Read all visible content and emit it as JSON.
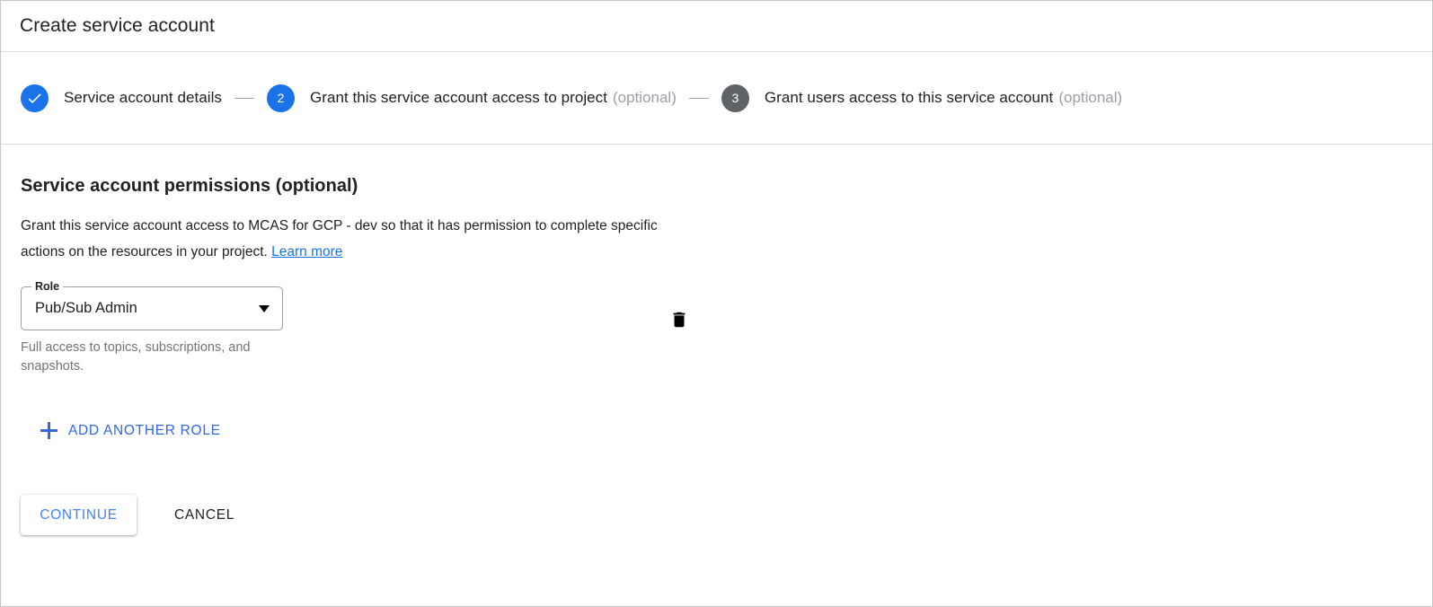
{
  "header": {
    "title": "Create service account"
  },
  "stepper": {
    "separator": "—",
    "steps": [
      {
        "indicator": "check",
        "state": "done",
        "label": "Service account details",
        "optional": ""
      },
      {
        "indicator": "2",
        "state": "active",
        "label": "Grant this service account access to project",
        "optional": "(optional)"
      },
      {
        "indicator": "3",
        "state": "inactive",
        "label": "Grant users access to this service account",
        "optional": "(optional)"
      }
    ]
  },
  "main": {
    "section_title": "Service account permissions (optional)",
    "description_part1": "Grant this service account access to MCAS for GCP - dev so that it has permission to complete specific actions on the resources in your project. ",
    "learn_more_label": "Learn more",
    "role_field": {
      "label": "Role",
      "value": "Pub/Sub Admin",
      "helper_text": "Full access to topics, subscriptions, and snapshots.",
      "dropdown_icon": "chevron-down-icon"
    },
    "delete_icon": "trash-icon",
    "add_another_role_label": "ADD ANOTHER ROLE",
    "add_icon": "plus-icon"
  },
  "actions": {
    "continue_label": "CONTINUE",
    "cancel_label": "CANCEL"
  },
  "colors": {
    "accent_blue": "#1a73e8",
    "link_blue": "#3367e0",
    "button_blue": "#4285f4",
    "inactive_gray": "#5f6368",
    "muted_gray": "#9aa0a6",
    "text": "#202124",
    "divider": "#dadce0"
  }
}
